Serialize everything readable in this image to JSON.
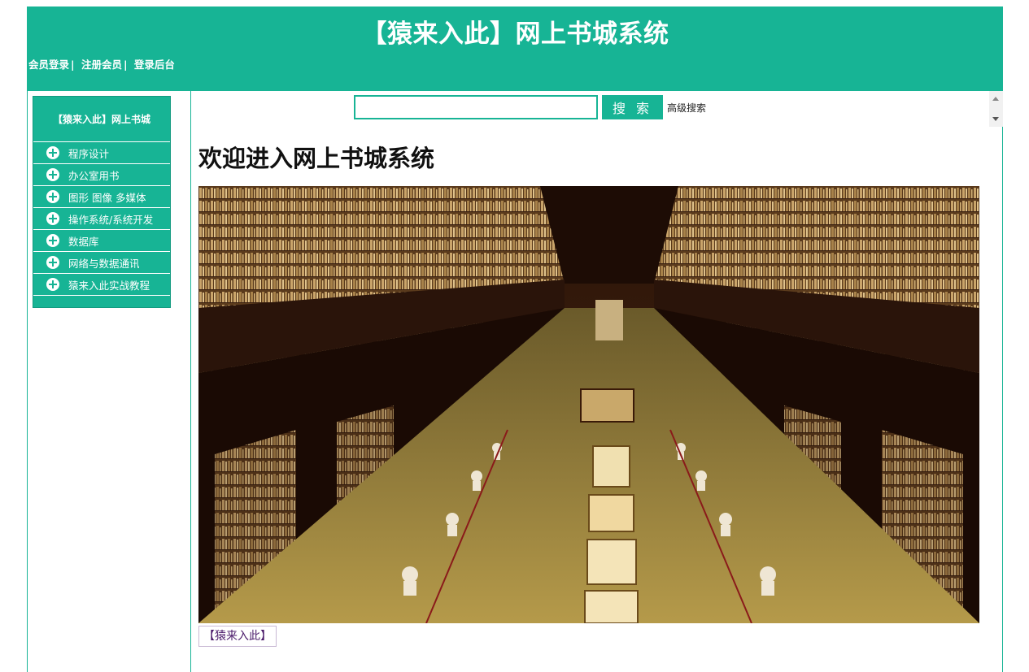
{
  "header": {
    "title": "【猿来入此】网上书城系统",
    "links": [
      {
        "label": "会员登录"
      },
      {
        "label": "注册会员"
      },
      {
        "label": "登录后台"
      }
    ],
    "separator": "|"
  },
  "sidebar": {
    "title": "【猿来入此】网上书城",
    "categories": [
      {
        "label": "程序设计",
        "icon": "plus-circle-icon"
      },
      {
        "label": "办公室用书",
        "icon": "plus-circle-icon"
      },
      {
        "label": "图形 图像 多媒体",
        "icon": "plus-circle-icon"
      },
      {
        "label": "操作系统/系统开发",
        "icon": "plus-circle-icon"
      },
      {
        "label": "数据库",
        "icon": "plus-circle-icon"
      },
      {
        "label": "网络与数据通讯",
        "icon": "plus-circle-icon"
      },
      {
        "label": "猿来入此实战教程",
        "icon": "plus-circle-icon"
      }
    ]
  },
  "search": {
    "value": "",
    "placeholder": "",
    "button_label": "搜 索",
    "advanced_label": "高级搜索"
  },
  "main": {
    "welcome": "欢迎进入网上书城系统",
    "footer_link": "【猿来入此】"
  },
  "colors": {
    "accent": "#17b495",
    "text": "#111111",
    "footer_link": "#4a1a6a"
  }
}
